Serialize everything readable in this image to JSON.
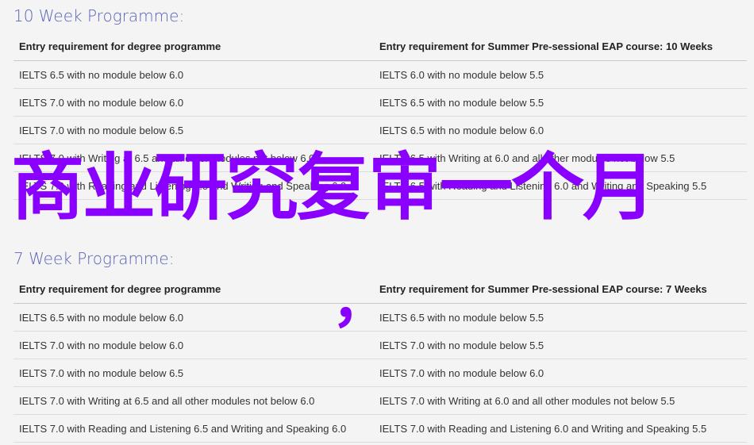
{
  "sections": [
    {
      "title": "10 Week Programme:",
      "headers": [
        "Entry requirement for degree programme",
        "Entry requirement for Summer Pre-sessional EAP course: 10 Weeks"
      ],
      "rows": [
        [
          "IELTS 6.5 with no module below 6.0",
          "IELTS 6.0 with no module below 5.5"
        ],
        [
          "IELTS 7.0 with no module below 6.0",
          "IELTS 6.5 with no module below 5.5"
        ],
        [
          "IELTS 7.0 with no module below 6.5",
          "IELTS 6.5 with no module below 6.0"
        ],
        [
          "IELTS 7.0 with Writing at 6.5 and all other modules not below 6.0",
          "IELTS 6.5 with Writing at 6.0 and all other modules not below 5.5"
        ],
        [
          "IELTS 7.0 with Reading and Listening 6.5 and Writing and Speaking 6.0",
          "IELTS 6.5 with Reading and Listening 6.0 and Writing and Speaking 5.5"
        ]
      ]
    },
    {
      "title": "7 Week Programme:",
      "headers": [
        "Entry requirement for degree programme",
        "Entry requirement for Summer Pre-sessional EAP course: 7 Weeks"
      ],
      "rows": [
        [
          "IELTS 6.5 with no module below 6.0",
          "IELTS 6.5 with no module below 5.5"
        ],
        [
          "IELTS 7.0 with no module below 6.0",
          "IELTS 7.0 with no module below 5.5"
        ],
        [
          "IELTS 7.0 with no module below 6.5",
          "IELTS 7.0 with no module below 6.0"
        ],
        [
          "IELTS 7.0 with Writing at 6.5 and all other modules not below 6.0",
          "IELTS 7.0 with Writing at 6.0 and all other modules not below 5.5"
        ],
        [
          "IELTS 7.0 with Reading and Listening 6.5 and Writing and Speaking 6.0",
          "IELTS 7.0 with Reading and Listening 6.0 and Writing and Speaking 5.5"
        ]
      ]
    }
  ],
  "overlay": {
    "text": "商业研究复审一个月",
    "comma": "，",
    "color": "#8a00ff"
  },
  "colors": {
    "title": "#5a63b8",
    "background": "#f4f4f4"
  }
}
